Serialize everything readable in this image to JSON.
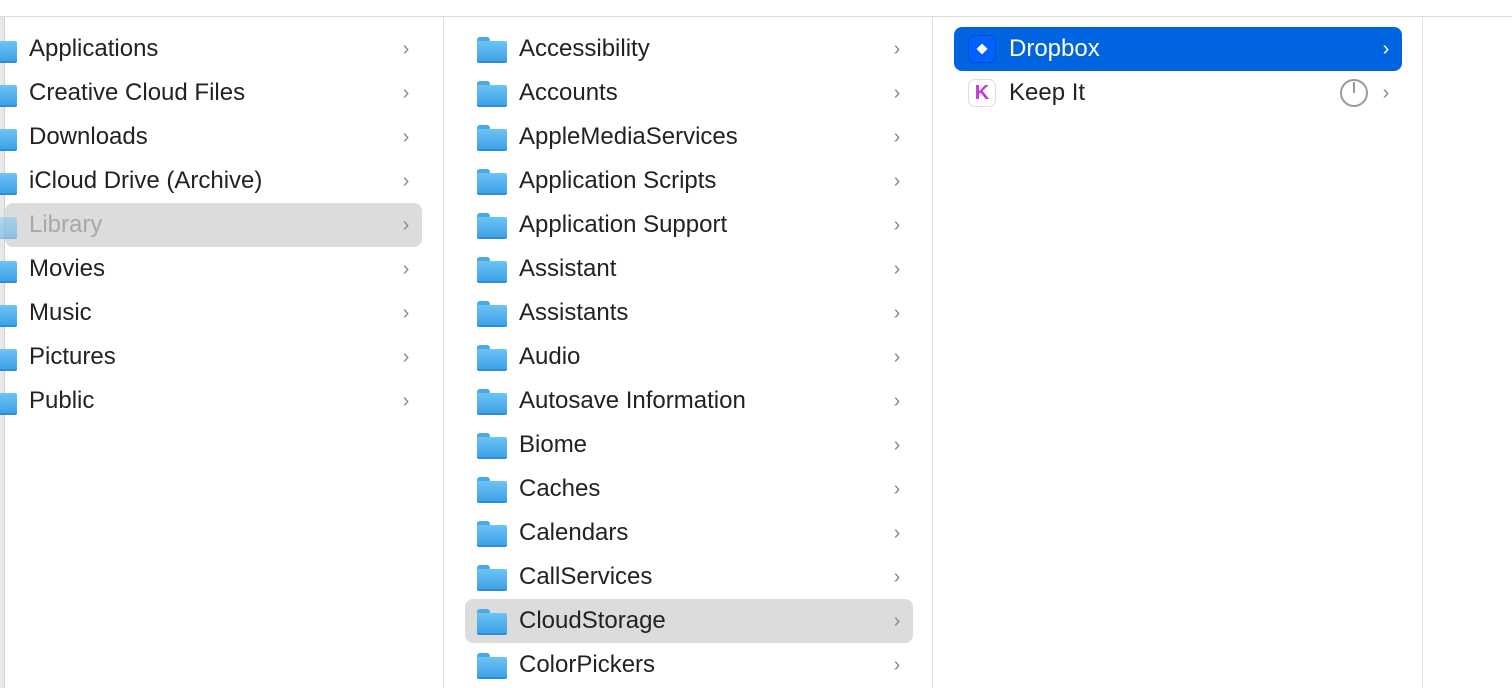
{
  "column1": {
    "items": [
      {
        "label": "Applications"
      },
      {
        "label": "Creative Cloud Files"
      },
      {
        "label": "Downloads"
      },
      {
        "label": "iCloud Drive (Archive)"
      },
      {
        "label": "Library",
        "selected": true
      },
      {
        "label": "Movies"
      },
      {
        "label": "Music"
      },
      {
        "label": "Pictures"
      },
      {
        "label": "Public"
      }
    ]
  },
  "column2": {
    "items": [
      {
        "label": "Accessibility"
      },
      {
        "label": "Accounts"
      },
      {
        "label": "AppleMediaServices"
      },
      {
        "label": "Application Scripts"
      },
      {
        "label": "Application Support"
      },
      {
        "label": "Assistant"
      },
      {
        "label": "Assistants"
      },
      {
        "label": "Audio"
      },
      {
        "label": "Autosave Information"
      },
      {
        "label": "Biome"
      },
      {
        "label": "Caches"
      },
      {
        "label": "Calendars"
      },
      {
        "label": "CallServices"
      },
      {
        "label": "CloudStorage",
        "selected": true
      },
      {
        "label": "ColorPickers"
      }
    ]
  },
  "column3": {
    "items": [
      {
        "label": "Dropbox",
        "icon": "dropbox-icon",
        "selected": true
      },
      {
        "label": "Keep It",
        "icon": "keep-it-icon",
        "status": "sync-progress-icon"
      }
    ]
  },
  "colors": {
    "selection_active": "#0064e0",
    "selection_inactive": "#dcdcdc",
    "folder": "#4aa8e8"
  }
}
